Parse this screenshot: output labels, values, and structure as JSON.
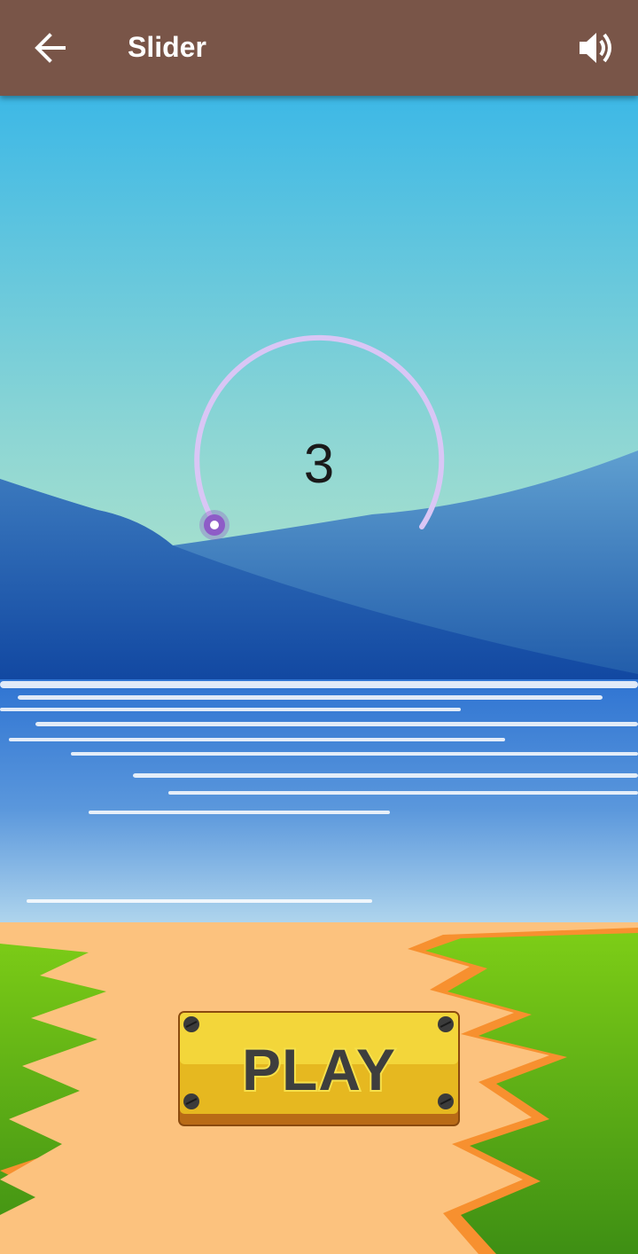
{
  "app_bar": {
    "title": "Slider",
    "back_icon": "arrow-back-icon",
    "sound_icon": "volume-up-icon",
    "color": "#795548"
  },
  "slider": {
    "value": "3",
    "track_color": "#d9c6f5",
    "thumb_color": "#8e5cc7"
  },
  "play_button": {
    "label": "PLAY",
    "color": "#f2d338"
  },
  "colors": {
    "sky_top": "#3db8e6",
    "sky_bottom": "#b8e6c8",
    "mountain": "#3a78bd",
    "water": "#3a7fd4",
    "sand": "#fcc27e",
    "grass": "#62bd1c"
  }
}
